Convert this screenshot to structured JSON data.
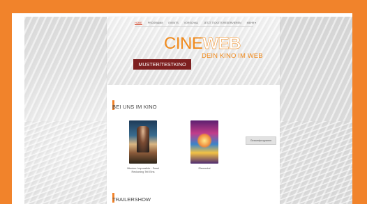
{
  "nav": {
    "items": [
      {
        "label": "HOME",
        "active": true
      },
      {
        "label": "PROGRAMM",
        "active": false
      },
      {
        "label": "EVENTS",
        "active": false
      },
      {
        "label": "VORSCHAU",
        "active": false
      },
      {
        "label": "JETZT TICKETS RESERVIEREN",
        "active": false
      },
      {
        "label": "MEHR",
        "active": false
      }
    ],
    "more_icon": "caret-down-icon"
  },
  "logo": {
    "part1": "CINE",
    "part2": "WEB"
  },
  "tagline": "DEIN KINO IM WEB",
  "kino_name": "MUSTER/TESTKINO",
  "sections": {
    "now_showing_title": "BEI UNS IM KINO",
    "trailer_title": "TRAILERSHOW"
  },
  "movies": [
    {
      "title": "Mission: Impossible - Dead Reckoning Teil Eins"
    },
    {
      "title": "Elemental"
    }
  ],
  "buttons": {
    "program": "Gesamtprogramm"
  },
  "icons": {
    "side": "info-icon",
    "corner": "chat-icon"
  },
  "colors": {
    "accent": "#f1832b",
    "brand_orange": "#f08a1c",
    "badge_bg": "#7d1f1f"
  }
}
